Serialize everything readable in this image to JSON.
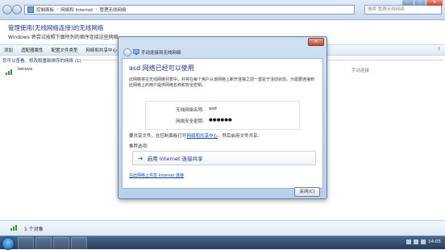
{
  "window": {
    "breadcrumb": [
      "控制面板",
      "网络和 Internet",
      "管理无线网络"
    ],
    "search_placeholder": "搜索 管理无线网络",
    "controls": {
      "minimize": "–",
      "maximize": "□",
      "close": "✕"
    },
    "page_title": "管理使用(无线网络连接)的无线网络",
    "page_desc": "Windows 将尝试按照下面所列的顺序连接这些网络。",
    "toolbar": [
      "添加",
      "适配器属性",
      "配置文件类型",
      "网络和共享中心"
    ],
    "toolbar_help": "?",
    "group_header": "您可以查看、修改和重新排序的网络 (1)",
    "network": {
      "name": "lenovo",
      "status": "手动连接"
    },
    "status_text": "1 个对象"
  },
  "dialog": {
    "title": "手动连接到无线网络",
    "close_label": "✕",
    "heading": "asd 网络已经可以使用",
    "intro": "此网络将在无线网络列表中，并将在每个用户从该网络上断开连接之前一直处于活动状态。为需要连接到此网络上的用户提供网络名称和安全密钥。",
    "network_name_label": "无线网络名称:",
    "network_name_value": "asd",
    "security_key_label": "网络安全密钥:",
    "security_key_value": "●●●●●●",
    "share_text_before": "要共享文件，在控制面板打开",
    "share_link": "网络和共享中心",
    "share_text_after": "，然后启用文件共享。",
    "suggest_label": "推荐选项:",
    "option_label": "启用 Internet 连接共享",
    "howto_link": "在此网络上共享 Internet 连接",
    "close_button": "关闭(C)"
  },
  "taskbar": {
    "time": "14:05"
  },
  "colors": {
    "accent": "#1e3287",
    "link": "#0645ad",
    "taskbar": "#263d5c"
  }
}
